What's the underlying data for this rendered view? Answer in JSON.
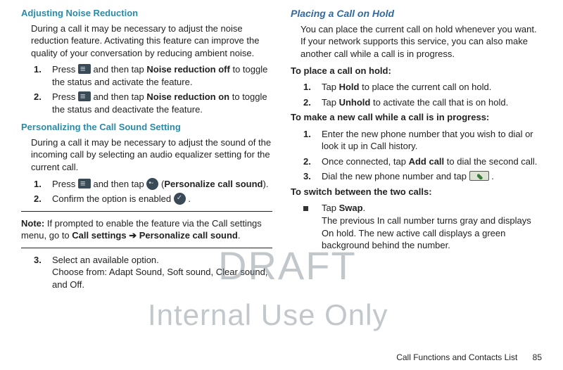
{
  "left": {
    "h1": "Adjusting Noise Reduction",
    "p1": "During a call it may be necessary to adjust the noise reduction feature. Activating this feature can improve the quality of your conversation by reducing ambient noise.",
    "items1": [
      {
        "num": "1.",
        "pre": "Press ",
        "bold": "Noise reduction off",
        "mid": " and then tap ",
        "post": " to toggle the status and activate the feature."
      },
      {
        "num": "2.",
        "pre": "Press ",
        "bold": "Noise reduction on",
        "mid": " and then tap ",
        "post": " to toggle the status and deactivate the feature."
      }
    ],
    "h2": "Personalizing the Call Sound Setting",
    "p2": "During a call it may be necessary to adjust the sound of the incoming call by selecting an audio equalizer setting for the current call.",
    "items2": [
      {
        "num": "1.",
        "pre": "Press ",
        "mid": " and then tap ",
        "bold": "Personalize call sound",
        "openParen": "  (",
        "closeParen": ")."
      },
      {
        "num": "2.",
        "text": "Confirm the option is enabled "
      }
    ],
    "noteLabel": "Note:",
    "noteText": " If prompted to enable the feature via the Call settings menu, go to ",
    "noteBold": "Call settings ➔ Personalize call sound",
    "noteEnd": ".",
    "items3": [
      {
        "num": "3.",
        "line1": "Select an available option.",
        "line2": "Choose from: Adapt Sound, Soft sound, Clear sound, and Off."
      }
    ]
  },
  "right": {
    "h1": "Placing a Call on Hold",
    "p1": "You can place the current call on hold whenever you want. If your network supports this service, you can also make another call while a call is in progress.",
    "sub1": "To place a call on hold:",
    "items1": [
      {
        "num": "1.",
        "pre": "Tap ",
        "bold": "Hold",
        "post": " to place the current call on hold."
      },
      {
        "num": "2.",
        "pre": "Tap ",
        "bold": "Unhold",
        "post": " to activate the call that is on hold."
      }
    ],
    "sub2": "To make a new call while a call is in progress:",
    "items2": [
      {
        "num": "1.",
        "text": "Enter the new phone number that you wish to dial or look it up in Call history."
      },
      {
        "num": "2.",
        "pre": "Once connected, tap ",
        "bold": "Add call",
        "post": " to dial the second call."
      },
      {
        "num": "3.",
        "pre": "Dial the new phone number and tap ",
        "post": "."
      }
    ],
    "sub3": "To switch between the two calls:",
    "bullet": {
      "pre": "Tap ",
      "bold": "Swap",
      "post": ".",
      "line2": "The previous In call number turns gray and displays On hold. The new active call displays a green background behind the number."
    }
  },
  "watermark1": "DRAFT",
  "watermark2": "Internal Use Only",
  "footerText": "Call Functions and Contacts List",
  "pageNum": "85"
}
